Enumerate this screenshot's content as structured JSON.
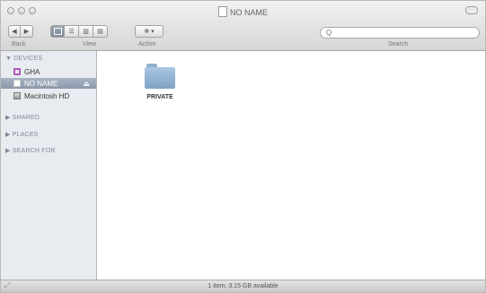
{
  "window": {
    "title": "NO NAME"
  },
  "toolbar": {
    "back_label": "Back",
    "view_label": "View",
    "action_label": "Action",
    "search_label": "Search",
    "search_placeholder": "Q"
  },
  "sidebar": {
    "sections": [
      {
        "label": "▼ DEVICES"
      },
      {
        "label": "▶ SHARED"
      },
      {
        "label": "▶ PLACES"
      },
      {
        "label": "▶ SEARCH FOR"
      }
    ],
    "devices": [
      {
        "label": "GHA",
        "selected": false,
        "icon": "drive-icon"
      },
      {
        "label": "NO NAME",
        "selected": true,
        "icon": "drive-icon"
      },
      {
        "label": "Macintosh HD",
        "selected": false,
        "icon": "harddisk-icon"
      }
    ]
  },
  "content": {
    "items": [
      {
        "label": "PRIVATE",
        "icon": "folder-icon"
      }
    ]
  },
  "status": {
    "text": "1 item, 3.15 GB available"
  }
}
